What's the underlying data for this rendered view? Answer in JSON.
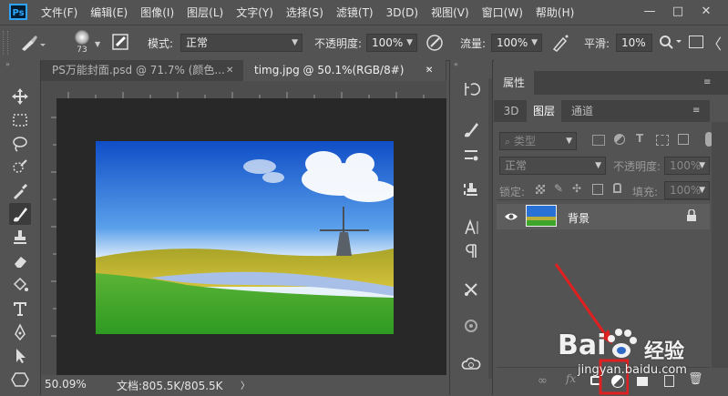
{
  "app": {
    "logo_text": "Ps"
  },
  "menu": [
    "文件(F)",
    "编辑(E)",
    "图像(I)",
    "图层(L)",
    "文字(Y)",
    "选择(S)",
    "滤镜(T)",
    "3D(D)",
    "视图(V)",
    "窗口(W)",
    "帮助(H)"
  ],
  "window_controls": {
    "minimize": "—",
    "maximize": "□",
    "close": "✕"
  },
  "options": {
    "brush_size": "73",
    "mode_label": "模式:",
    "mode_value": "正常",
    "opacity_label": "不透明度:",
    "opacity_value": "100%",
    "flow_label": "流量:",
    "flow_value": "100%",
    "smooth_label": "平滑:",
    "smooth_value": "10%"
  },
  "doc_tabs": [
    {
      "label": "PS万能封面.psd @ 71.7% (颜色...",
      "close": "✕",
      "active": false
    },
    {
      "label": "timg.jpg @ 50.1%(RGB/8#)",
      "close": "✕",
      "active": true
    }
  ],
  "status": {
    "zoom": "50.09%",
    "doc_label": "文档:805.5K/805.5K",
    "arrow": "〉"
  },
  "panels": {
    "properties_title": "属性",
    "tabs": [
      "3D",
      "图层",
      "通道"
    ],
    "filter_kind": "类型",
    "blend_mode": "正常",
    "opacity_label": "不透明度:",
    "opacity_value": "100%",
    "lock_label": "锁定:",
    "fill_label": "填充:",
    "fill_value": "100%",
    "layer_name": "背景"
  },
  "watermark": {
    "brand": "Bai",
    "brand2": "经验",
    "url": "jingyan.baidu.com"
  },
  "colors": {
    "accent": "#e02020",
    "ps_blue": "#31a8ff"
  }
}
